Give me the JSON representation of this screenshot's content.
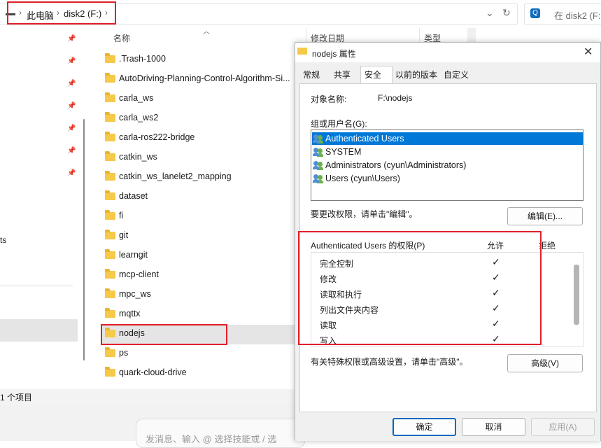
{
  "explorer": {
    "breadcrumb": [
      "此电脑",
      "disk2 (F:)"
    ],
    "breadcrumb_more": "›",
    "search_placeholder": "在 disk2 (F:",
    "columns": {
      "name": "名称",
      "modified": "修改日期",
      "type": "类型"
    },
    "nav_partial_text": "ts",
    "files": [
      ".Trash-1000",
      "AutoDriving-Planning-Control-Algorithm-Si...",
      "carla_ws",
      "carla_ws2",
      "carla-ros222-bridge",
      "catkin_ws",
      "catkin_ws_lanelet2_mapping",
      "dataset",
      "fi",
      "git",
      "learngit",
      "mcp-client",
      "mpc_ws",
      "mqttx",
      "nodejs",
      "ps",
      "quark-cloud-drive"
    ],
    "status": "1 个项目",
    "chat_placeholder": "发消息、输入 @ 选择技能或 / 选"
  },
  "dialog": {
    "title": "nodejs 属性",
    "tabs": [
      "常规",
      "共享",
      "安全",
      "以前的版本",
      "自定义"
    ],
    "active_tab": "安全",
    "object_label": "对象名称:",
    "object_value": "F:\\nodejs",
    "groups_label": "组或用户名(G):",
    "users": [
      "Authenticated Users",
      "SYSTEM",
      "Administrators (cyun\\Administrators)",
      "Users (cyun\\Users)"
    ],
    "change_hint": "要更改权限，请单击\"编辑\"。",
    "edit_button": "编辑(E)...",
    "perm_header": "Authenticated Users 的权限(P)",
    "allow_header": "允许",
    "deny_header": "拒绝",
    "permissions": [
      {
        "name": "完全控制",
        "allow": "✓"
      },
      {
        "name": "修改",
        "allow": "✓"
      },
      {
        "name": "读取和执行",
        "allow": "✓"
      },
      {
        "name": "列出文件夹内容",
        "allow": "✓"
      },
      {
        "name": "读取",
        "allow": "✓"
      },
      {
        "name": "写入",
        "allow": "✓"
      }
    ],
    "advanced_hint": "有关特殊权限或高级设置，请单击\"高级\"。",
    "advanced_button": "高级(V)",
    "ok_button": "确定",
    "cancel_button": "取消",
    "apply_button": "应用(A)"
  },
  "colors": {
    "accent": "#0078d7",
    "highlight": "#e0202a",
    "folder": "#f7c948"
  }
}
